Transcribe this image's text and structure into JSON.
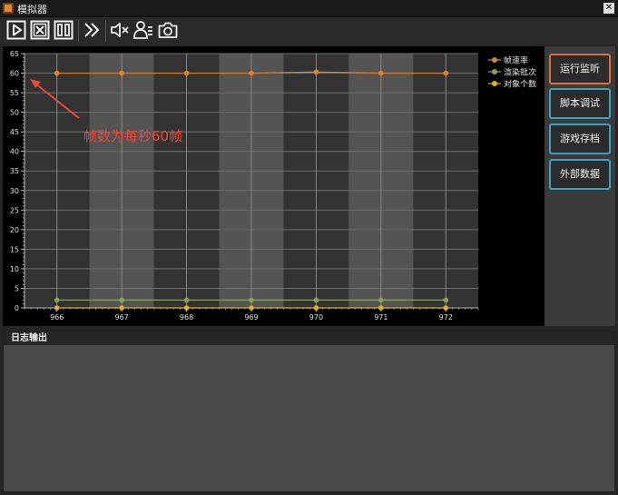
{
  "window": {
    "title": "模拟器"
  },
  "toolbar": {
    "icons": [
      "play-icon",
      "stop-icon",
      "pause-icon",
      "fast-forward-icon",
      "mute-icon",
      "user-list-icon",
      "camera-icon"
    ]
  },
  "side_buttons": [
    {
      "label": "运行监听",
      "active": true
    },
    {
      "label": "脚本调试",
      "active": false
    },
    {
      "label": "游戏存档",
      "active": false
    },
    {
      "label": "外部数据",
      "active": false
    }
  ],
  "annotation": {
    "text": "帧数为每秒60帧",
    "color": "#e84a3a"
  },
  "log": {
    "title": "日志输出"
  },
  "chart_data": {
    "type": "line",
    "x": [
      966,
      967,
      968,
      969,
      970,
      971,
      972
    ],
    "ylim": [
      0,
      65
    ],
    "yticks": [
      0,
      5,
      10,
      15,
      20,
      25,
      30,
      35,
      40,
      45,
      50,
      55,
      60,
      65
    ],
    "grid": true,
    "legend_position": "top-right",
    "series": [
      {
        "name": "帧速率",
        "color": "#d9843a",
        "values": [
          60,
          60,
          60,
          60,
          60.3,
          60,
          60
        ]
      },
      {
        "name": "渲染批次",
        "color": "#8aa060",
        "values": [
          2,
          2,
          2,
          2,
          2,
          2,
          2
        ]
      },
      {
        "name": "对象个数",
        "color": "#e0b020",
        "values": [
          0,
          0,
          0,
          0,
          0,
          0,
          0
        ]
      }
    ]
  }
}
